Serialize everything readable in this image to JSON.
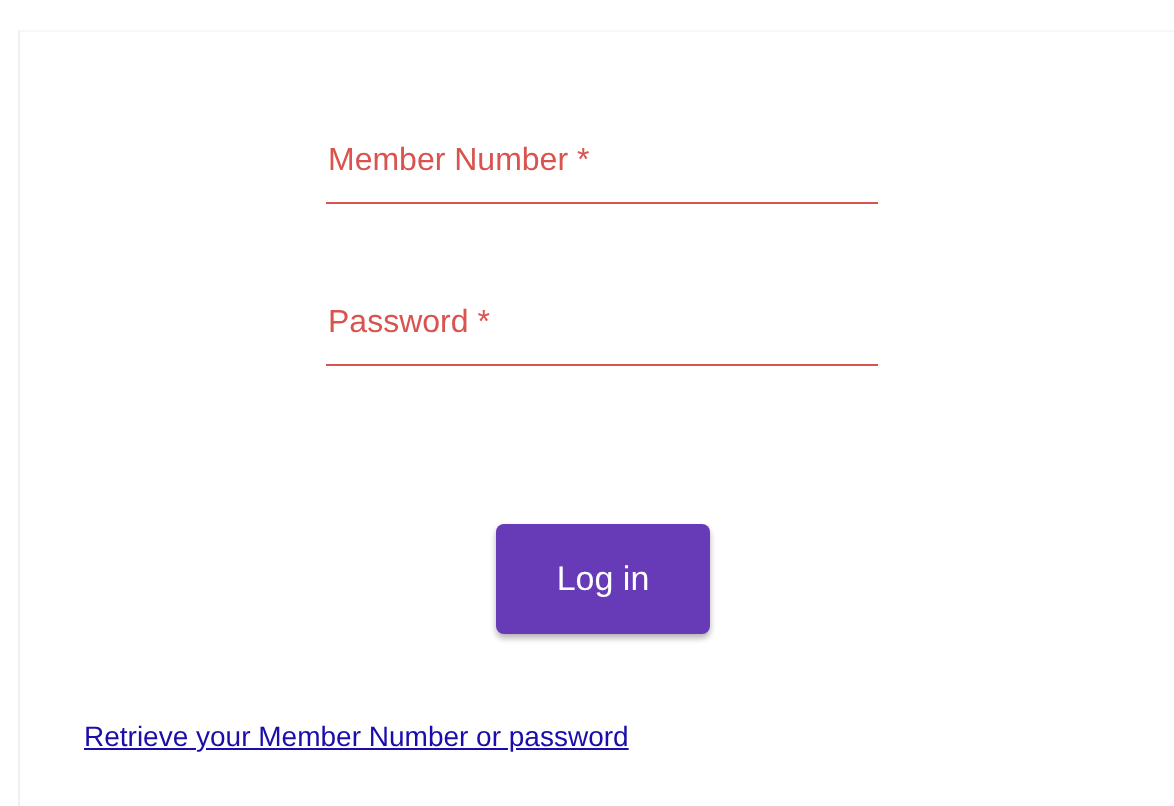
{
  "fields": [
    {
      "placeholder": "Member Number *",
      "error": true
    },
    {
      "placeholder": "Password *",
      "error": true
    }
  ],
  "submit_button": {
    "label": "Log in"
  },
  "retrieve_link": {
    "label": "Retrieve your Member Number or password"
  }
}
